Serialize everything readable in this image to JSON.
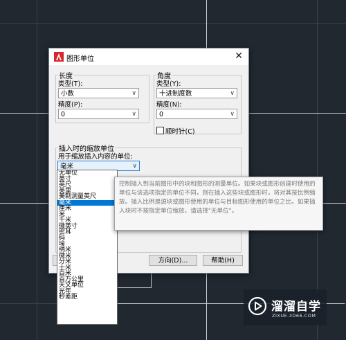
{
  "dialog": {
    "title": "图形单位",
    "close_glyph": "✕",
    "length": {
      "group_label": "长度",
      "type_label": "类型(T):",
      "type_value": "小数",
      "precision_label": "精度(P):",
      "precision_value": "0"
    },
    "angle": {
      "group_label": "角度",
      "type_label": "类型(Y):",
      "type_value": "十进制度数",
      "precision_label": "精度(N):",
      "precision_value": "0",
      "clockwise_label": "顺时针(C)"
    },
    "insertion": {
      "group_label": "插入时的缩放单位",
      "prompt": "用于缩放插入内容的单位:",
      "value": "毫米"
    },
    "buttons": {
      "direction": "方向(D)...",
      "help": "帮助(H)"
    }
  },
  "unit_list": {
    "items": [
      "无单位",
      "英寸",
      "英尺",
      "英里",
      "美制测量英尺",
      "毫米",
      "厘米",
      "米",
      "千米",
      "微英寸",
      "密耳",
      "码",
      "埃",
      "纳米",
      "微米",
      "分米",
      "十米",
      "百米",
      "百万公里",
      "天文单位",
      "光年",
      "秒差距"
    ],
    "selected_index": 5
  },
  "tooltip": {
    "text": "控制插入到当前图形中的块和图形的测量单位。如果块或图形创建时使用的单位与该选项指定的单位不同，则在插入这些块或图形时，将对其按比例缩放。插入比例是源块或图形使用的单位与目标图形使用的单位之比。如果插入块时不按指定单位缩放，请选择\"无单位\"。"
  },
  "watermark": {
    "main": "溜溜自学",
    "sub": "ZIXUE.3D66.COM"
  },
  "colors": {
    "canvas_bg": "#212830",
    "selection": "#0078d7",
    "app_icon": "#d9262c"
  }
}
